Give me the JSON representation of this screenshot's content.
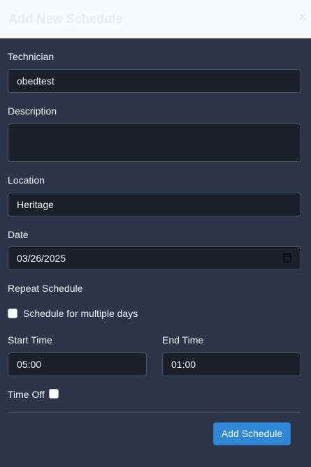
{
  "modal": {
    "title": "Add New Schedule",
    "close_symbol": "×"
  },
  "form": {
    "technician": {
      "label": "Technician",
      "value": "obedtest"
    },
    "description": {
      "label": "Description",
      "value": ""
    },
    "location": {
      "label": "Location",
      "value": "Heritage"
    },
    "date": {
      "label": "Date",
      "value": "03/26/2025",
      "icon": "calendar-icon"
    },
    "repeat": {
      "label": "Repeat Schedule",
      "multiple_days_label": "Schedule for multiple days",
      "checked": false
    },
    "start_time": {
      "label": "Start Time",
      "value": "05:00"
    },
    "end_time": {
      "label": "End Time",
      "value": "01:00"
    },
    "time_off": {
      "label": "Time Off",
      "checked": false
    }
  },
  "actions": {
    "submit_label": "Add Schedule"
  },
  "colors": {
    "background": "#2d3648",
    "field_background": "#1c202b",
    "accent": "#2f87d8"
  }
}
